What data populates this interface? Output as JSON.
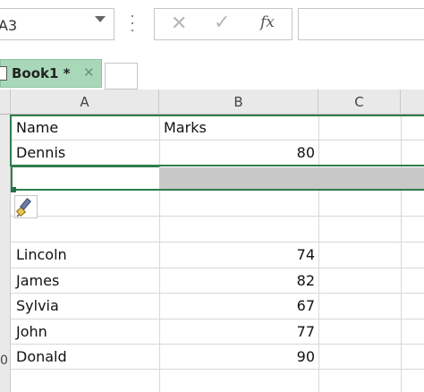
{
  "formula_bar": {
    "name_box": "A3",
    "fx_label": "fx",
    "formula_value": ""
  },
  "tabs": [
    {
      "label": "Book1 *",
      "active": true
    }
  ],
  "columns": [
    "A",
    "B",
    "C"
  ],
  "rows": [
    {
      "a": "Name",
      "b": "Marks"
    },
    {
      "a": "Dennis",
      "b": "80"
    },
    {
      "a": "",
      "b": ""
    },
    {
      "a": "",
      "b": ""
    },
    {
      "a": "",
      "b": ""
    },
    {
      "a": "Lincoln",
      "b": "74"
    },
    {
      "a": "James",
      "b": "82"
    },
    {
      "a": "Sylvia",
      "b": "67"
    },
    {
      "a": "John",
      "b": "77"
    },
    {
      "a": "Donald",
      "b": "90"
    }
  ],
  "row_edge_label": "0",
  "colors": {
    "tab_active": "#a9d8b8",
    "selection_border": "#2e7d4b",
    "header_bg": "#e9e9e9"
  }
}
